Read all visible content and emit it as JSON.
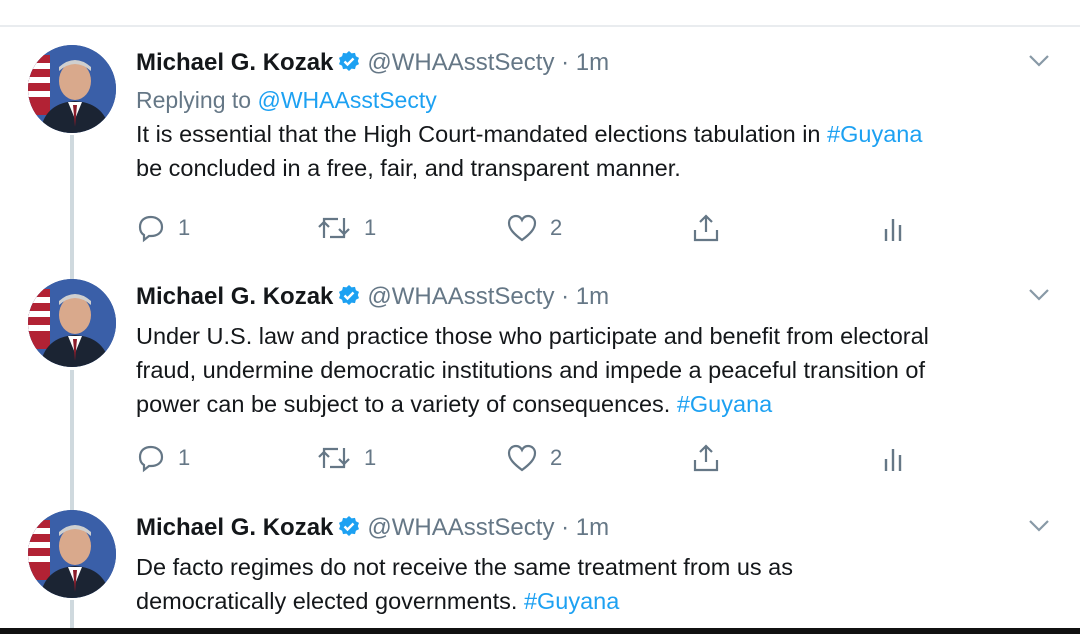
{
  "tweets": [
    {
      "name": "Michael G. Kozak",
      "handle": "@WHAAsstSecty",
      "separator": "·",
      "time": "1m",
      "replying_prefix": "Replying to",
      "replying_to": "@WHAAsstSecty",
      "text_line1": "It is essential that the High Court-mandated elections tabulation in ",
      "hashtag1": "#Guyana",
      "text_line2": " be concluded in a free, fair, and transparent manner.",
      "replies": "1",
      "retweets": "1",
      "likes": "2"
    },
    {
      "name": "Michael G. Kozak",
      "handle": "@WHAAsstSecty",
      "separator": "·",
      "time": "1m",
      "text_line1": "Under U.S. law and practice those who participate and benefit from electoral",
      "text_line2": "fraud, undermine democratic institutions and impede a peaceful transition of",
      "text_line3": "power can be subject to a variety of consequences. ",
      "hashtag": "#Guyana",
      "replies": "1",
      "retweets": "1",
      "likes": "2"
    },
    {
      "name": "Michael G. Kozak",
      "handle": "@WHAAsstSecty",
      "separator": "·",
      "time": "1m",
      "text_line1": "De facto regimes do not receive the same treatment from us as",
      "text_line2": "democratically elected governments. ",
      "hashtag": "#Guyana"
    }
  ],
  "colors": {
    "link": "#1da1f2",
    "secondary_text": "#657786",
    "verified_badge": "#1da1f2"
  },
  "icons": [
    "reply-icon",
    "retweet-icon",
    "like-icon",
    "share-icon",
    "analytics-icon",
    "verified-badge-icon",
    "chevron-down-icon"
  ]
}
